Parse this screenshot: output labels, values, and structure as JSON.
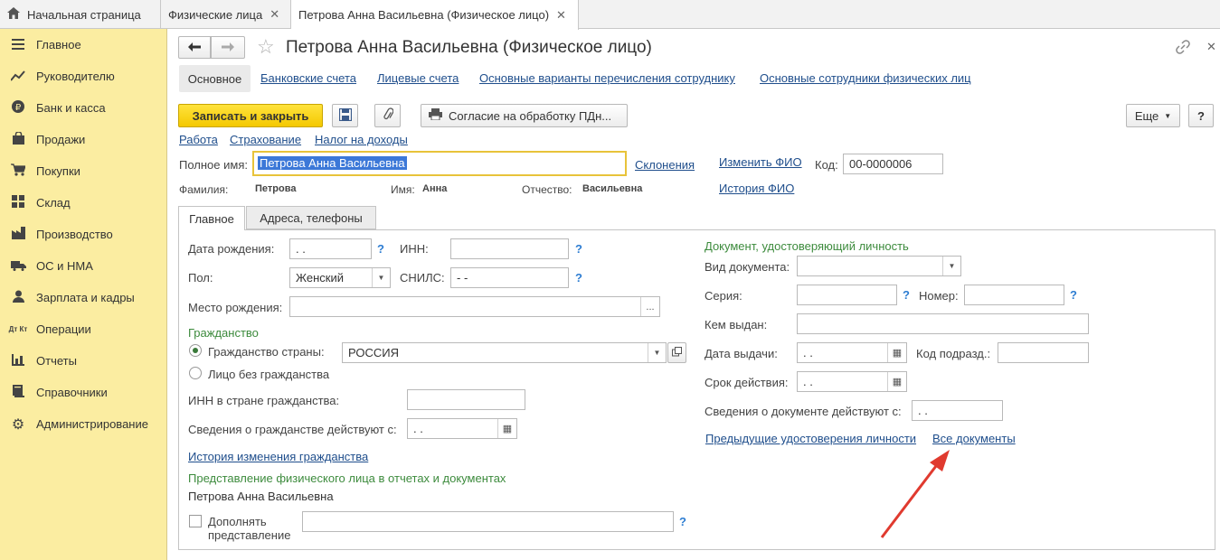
{
  "top_tabs": [
    {
      "label": "Начальная страница"
    },
    {
      "label": "Физические лица"
    },
    {
      "label": "Петрова Анна Васильевна (Физическое лицо)"
    }
  ],
  "sidebar": {
    "items": [
      {
        "label": "Главное",
        "icon": "menu-icon"
      },
      {
        "label": "Руководителю",
        "icon": "chart-line-icon"
      },
      {
        "label": "Банк и касса",
        "icon": "ruble-icon"
      },
      {
        "label": "Продажи",
        "icon": "bag-icon"
      },
      {
        "label": "Покупки",
        "icon": "cart-icon"
      },
      {
        "label": "Склад",
        "icon": "grid-icon"
      },
      {
        "label": "Производство",
        "icon": "factory-icon"
      },
      {
        "label": "ОС и НМА",
        "icon": "truck-icon"
      },
      {
        "label": "Зарплата и кадры",
        "icon": "person-icon"
      },
      {
        "label": "Операции",
        "icon": "dt-kt-icon",
        "glyph": "Дт Кт"
      },
      {
        "label": "Отчеты",
        "icon": "bar-chart-icon"
      },
      {
        "label": "Справочники",
        "icon": "book-icon"
      },
      {
        "label": "Администрирование",
        "icon": "gear-icon"
      }
    ]
  },
  "form": {
    "title": "Петрова Анна Васильевна (Физическое лицо)",
    "section_tabs": [
      "Основное",
      "Банковские счета",
      "Лицевые счета",
      "Основные варианты перечисления сотруднику",
      "Основные сотрудники физических лиц"
    ],
    "toolbar": {
      "save_close": "Записать и закрыть",
      "consent": "Согласие на обработку ПДн...",
      "more": "Еще",
      "help": "?"
    },
    "sublinks": [
      "Работа",
      "Страхование",
      "Налог на доходы"
    ],
    "fullname_label": "Полное имя:",
    "fullname_value": "Петрова Анна Васильевна",
    "declensions": "Склонения",
    "change_fio": "Изменить ФИО",
    "fio_history": "История ФИО",
    "code_label": "Код:",
    "code_value": "00-0000006",
    "surname_label": "Фамилия:",
    "surname_value": "Петрова",
    "name_label": "Имя:",
    "name_value": "Анна",
    "patronymic_label": "Отчество:",
    "patronymic_value": "Васильевна",
    "inner_tabs": [
      "Главное",
      "Адреса, телефоны"
    ],
    "main": {
      "birthdate_label": "Дата рождения:",
      "birthdate_value": " .  .",
      "inn_label": "ИНН:",
      "gender_label": "Пол:",
      "gender_value": "Женский",
      "snils_label": "СНИЛС:",
      "snils_value": " -  -",
      "birthplace_label": "Место рождения:",
      "citizenship_header": "Гражданство",
      "citizenship_country_label": "Гражданство страны:",
      "citizenship_country_value": "РОССИЯ",
      "stateless_label": "Лицо без гражданства",
      "inn_country_label": "ИНН в стране гражданства:",
      "citizenship_from_label": "Сведения о гражданстве действуют с:",
      "citizenship_from_value": " .  .",
      "citizenship_history": "История изменения гражданства",
      "representation_header": "Представление физического лица в отчетах и документах",
      "representation_value": "Петрова Анна Васильевна",
      "extend_label": "Дополнять представление",
      "ellipsis": "...",
      "question": "?"
    },
    "doc": {
      "header": "Документ, удостоверяющий личность",
      "type_label": "Вид документа:",
      "series_label": "Серия:",
      "number_label": "Номер:",
      "issued_by_label": "Кем выдан:",
      "issue_date_label": "Дата выдачи:",
      "issue_date_value": " .  .",
      "dept_code_label": "Код подразд.:",
      "valid_label": "Срок действия:",
      "valid_value": " .  .",
      "valid_from_label": "Сведения о документе действуют с:",
      "valid_from_value": " .  .",
      "prev_docs": "Предыдущие удостоверения личности",
      "all_docs": "Все документы"
    }
  },
  "colors": {
    "sidebar_bg": "#fbeda1",
    "primary_button": "#f4c800",
    "link": "#1f4e8c",
    "section_header": "#3d8b3d",
    "help_mark": "#2d7dd2",
    "focus_border": "#e8c33a",
    "selection": "#3c78d8",
    "annotation_arrow": "#e03a2f"
  }
}
